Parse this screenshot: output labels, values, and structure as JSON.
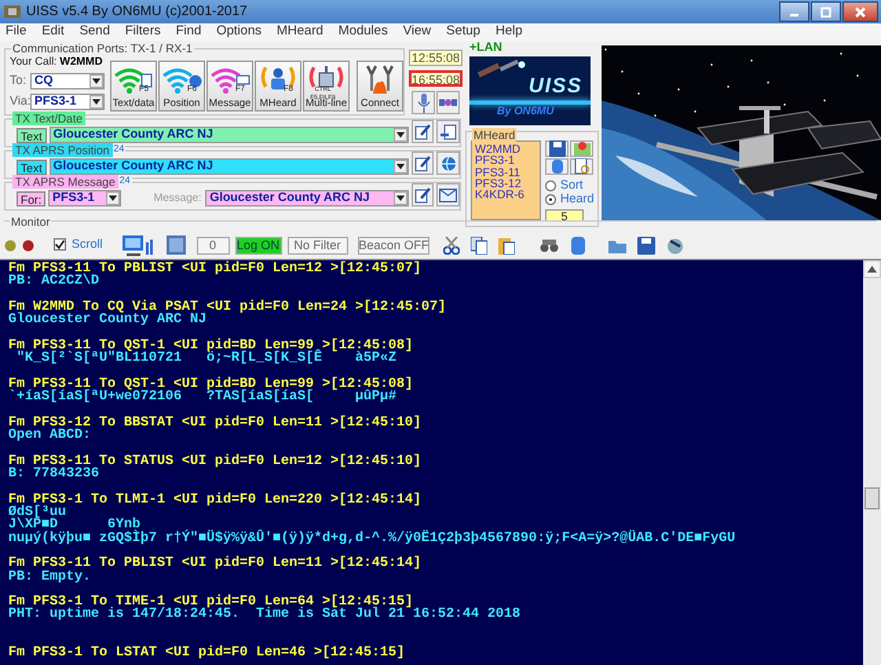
{
  "window": {
    "title": "UISS v5.4 By ON6MU (c)2001-2017"
  },
  "menu": [
    "File",
    "Edit",
    "Send",
    "Filters",
    "Find",
    "Options",
    "MHeard",
    "Modules",
    "View",
    "Setup",
    "Help"
  ],
  "comm_ports": {
    "legend": "Communication Ports: TX-1 / RX-1",
    "your_call_label": "Your Call:",
    "your_call": "W2MMD",
    "to_label": "To:",
    "to": "CQ",
    "via_label": "Via:",
    "via": "PFS3-1",
    "buttons": [
      {
        "label": "Text/data",
        "key": "F5",
        "kind": "text"
      },
      {
        "label": "Position",
        "key": "F6",
        "kind": "position"
      },
      {
        "label": "Message",
        "key": "F7",
        "kind": "message"
      },
      {
        "label": "MHeard",
        "key": "F8",
        "kind": "mheard"
      },
      {
        "label": "Multi-line",
        "key": "CTRL F5,F8,F9",
        "kind": "multiline"
      },
      {
        "label": "Connect",
        "kind": "connect"
      }
    ]
  },
  "clocks": [
    {
      "time": "12:55:08",
      "kind": "local"
    },
    {
      "time": "16:55:08",
      "kind": "utc"
    }
  ],
  "tx_text": {
    "legend": "TX Text/Date",
    "button": "Text",
    "value": "Gloucester County ARC NJ"
  },
  "tx_position": {
    "legend": "TX APRS Position",
    "count": "24",
    "button": "Text",
    "value": "Gloucester County ARC NJ"
  },
  "tx_message": {
    "legend": "TX APRS Message",
    "count": "24",
    "for_label": "For:",
    "for": "PFS3-1",
    "message_label": "Message:",
    "value": "Gloucester County ARC NJ"
  },
  "monitor": {
    "legend": "Monitor",
    "scroll_label": "Scroll",
    "scroll_checked": true,
    "counter": "0",
    "log": "Log ON",
    "filter": "No Filter",
    "beacon": "Beacon OFF"
  },
  "lan": {
    "label": "+LAN",
    "logo_title": "UISS",
    "logo_byline": "By ON6MU"
  },
  "mheard": {
    "legend": "MHeard",
    "stations": [
      "W2MMD",
      "PFS3-1",
      "PFS3-11",
      "PFS3-12",
      "K4KDR-6"
    ],
    "sort_options": [
      {
        "label": "Sort",
        "selected": false
      },
      {
        "label": "Heard",
        "selected": true
      }
    ],
    "count": "5"
  },
  "console": {
    "lines": [
      {
        "kind": "header",
        "text": "Fm PFS3-11 To PBLIST <UI pid=F0 Len=12 >[12:45:07]"
      },
      {
        "kind": "data",
        "text": "PB: AC2CZ\\D"
      },
      {
        "kind": "blank"
      },
      {
        "kind": "header",
        "text": "Fm W2MMD To CQ Via PSAT <UI pid=F0 Len=24 >[12:45:07]"
      },
      {
        "kind": "data",
        "text": "Gloucester County ARC NJ"
      },
      {
        "kind": "blank"
      },
      {
        "kind": "header",
        "text": "Fm PFS3-11 To QST-1 <UI pid=BD Len=99 >[12:45:08]"
      },
      {
        "kind": "data",
        "text": " \"K_S[²`S[ªU\"BL110721   ö;~R[L_S[K_S[Ê    à5P«Z"
      },
      {
        "kind": "blank"
      },
      {
        "kind": "header",
        "text": "Fm PFS3-11 To QST-1 <UI pid=BD Len=99 >[12:45:08]"
      },
      {
        "kind": "data",
        "text": "`+íaS[íaS[ªU+we072106   ?TAS[íaS[íaS[     µûPµ#"
      },
      {
        "kind": "blank"
      },
      {
        "kind": "header",
        "text": "Fm PFS3-12 To BBSTAT <UI pid=F0 Len=11 >[12:45:10]"
      },
      {
        "kind": "data",
        "text": "Open ABCD:"
      },
      {
        "kind": "blank"
      },
      {
        "kind": "header",
        "text": "Fm PFS3-11 To STATUS <UI pid=F0 Len=12 >[12:45:10]"
      },
      {
        "kind": "data",
        "text": "B: 77843236"
      },
      {
        "kind": "blank"
      },
      {
        "kind": "header",
        "text": "Fm PFS3-1 To TLMI-1 <UI pid=F0 Len=220 >[12:45:14]"
      },
      {
        "kind": "data",
        "text": "ØdS[³uu"
      },
      {
        "kind": "data",
        "text": "J\\XP■D      6Ynb"
      },
      {
        "kind": "data",
        "text": "nuµý(kÿþu■ zGQ$Ìþ7 r†Ý\"■Ü$ÿ%ÿ&Û'■(ÿ)ÿ*d+g,d-^.%/ÿ0Ë1Ç2þ3þ4567890:ÿ;F<A=ÿ>?@ÜAB.C'DE■FyGU"
      },
      {
        "kind": "blank"
      },
      {
        "kind": "header",
        "text": "Fm PFS3-11 To PBLIST <UI pid=F0 Len=11 >[12:45:14]"
      },
      {
        "kind": "data",
        "text": "PB: Empty."
      },
      {
        "kind": "blank"
      },
      {
        "kind": "header",
        "text": "Fm PFS3-1 To TIME-1 <UI pid=F0 Len=64 >[12:45:15]"
      },
      {
        "kind": "data",
        "text": "PHT: uptime is 147/18:24:45.  Time is Sat Jul 21 16:52:44 2018"
      },
      {
        "kind": "blank"
      },
      {
        "kind": "blank"
      },
      {
        "kind": "header",
        "text": "Fm PFS3-1 To LSTAT <UI pid=F0 Len=46 >[12:45:15]"
      }
    ]
  }
}
